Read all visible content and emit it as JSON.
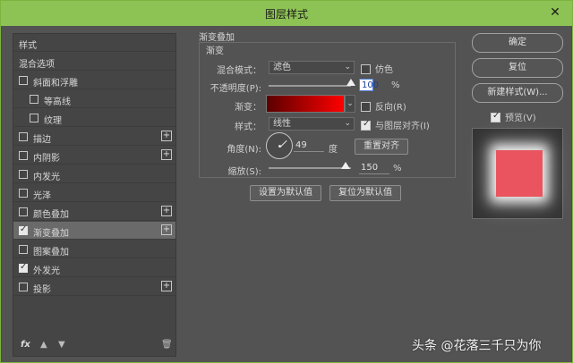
{
  "window": {
    "title": "图层样式"
  },
  "left_panel": {
    "items": [
      {
        "label": "样式",
        "checkbox": false,
        "checked": false,
        "plus": false,
        "indent": 0,
        "selected": false
      },
      {
        "label": "混合选项",
        "checkbox": false,
        "checked": false,
        "plus": false,
        "indent": 0,
        "selected": false
      },
      {
        "label": "斜面和浮雕",
        "checkbox": true,
        "checked": false,
        "plus": false,
        "indent": 0,
        "selected": false
      },
      {
        "label": "等高线",
        "checkbox": true,
        "checked": false,
        "plus": false,
        "indent": 1,
        "selected": false
      },
      {
        "label": "纹理",
        "checkbox": true,
        "checked": false,
        "plus": false,
        "indent": 1,
        "selected": false
      },
      {
        "label": "描边",
        "checkbox": true,
        "checked": false,
        "plus": true,
        "indent": 0,
        "selected": false
      },
      {
        "label": "内阴影",
        "checkbox": true,
        "checked": false,
        "plus": true,
        "indent": 0,
        "selected": false
      },
      {
        "label": "内发光",
        "checkbox": true,
        "checked": false,
        "plus": false,
        "indent": 0,
        "selected": false
      },
      {
        "label": "光泽",
        "checkbox": true,
        "checked": false,
        "plus": false,
        "indent": 0,
        "selected": false
      },
      {
        "label": "颜色叠加",
        "checkbox": true,
        "checked": false,
        "plus": true,
        "indent": 0,
        "selected": false
      },
      {
        "label": "渐变叠加",
        "checkbox": true,
        "checked": true,
        "plus": true,
        "indent": 0,
        "selected": true
      },
      {
        "label": "图案叠加",
        "checkbox": true,
        "checked": false,
        "plus": false,
        "indent": 0,
        "selected": false
      },
      {
        "label": "外发光",
        "checkbox": true,
        "checked": true,
        "plus": false,
        "indent": 0,
        "selected": false
      },
      {
        "label": "投影",
        "checkbox": true,
        "checked": false,
        "plus": true,
        "indent": 0,
        "selected": false
      }
    ],
    "footer": {
      "fx": "fx",
      "up": "▲",
      "down": "▼",
      "trash": "🗑"
    }
  },
  "gradient_overlay": {
    "section_title": "渐变叠加",
    "group_title": "渐变",
    "blend_mode_label": "混合模式：",
    "blend_mode_value": "滤色",
    "dither_label": "仿色",
    "opacity_label": "不透明度(P):",
    "opacity_value": "100",
    "opacity_unit": "%",
    "opacity_level": 100,
    "gradient_label": "渐变：",
    "gradient_start_color": "#5a0000",
    "gradient_end_color": "#ff0000",
    "reverse_label": "反向(R)",
    "style_label": "样式：",
    "style_value": "线性",
    "align_label": "与图层对齐(I)",
    "angle_label": "角度(N):",
    "angle_value": "49",
    "angle_unit": "度",
    "reset_align_button": "重置对齐",
    "scale_label": "缩放(S):",
    "scale_value": "150",
    "scale_unit": "%",
    "scale_level": 150,
    "set_default_button": "设置为默认值",
    "reset_default_button": "复位为默认值"
  },
  "right_panel": {
    "ok_button": "确定",
    "reset_button": "复位",
    "new_style_button": "新建样式(W)...",
    "preview_label": "预览(V)",
    "preview_checked": true,
    "preview_fill_color": "#ea545e"
  },
  "watermark": "头条 @花落三千只为你",
  "colors": {
    "titlebar": "#8dc254",
    "panel_bg": "#535353",
    "accent_focus": "#4e7fd6"
  }
}
